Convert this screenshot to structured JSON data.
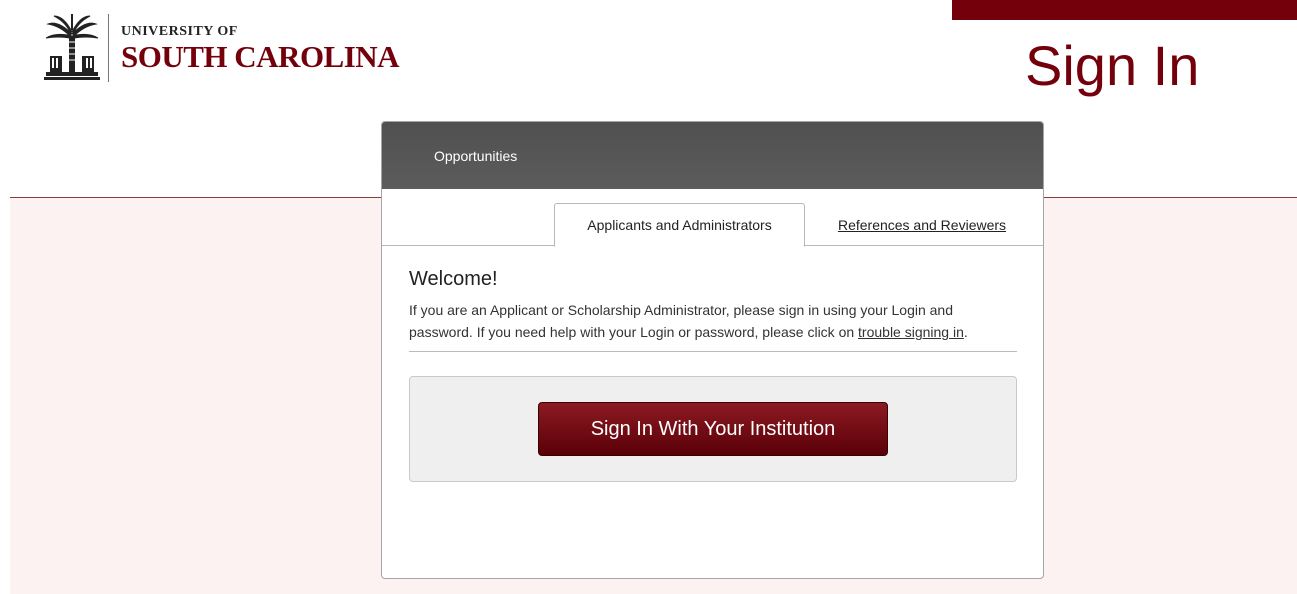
{
  "header": {
    "logo_small": "UNIVERSITY OF",
    "logo_big": "SOUTH CAROLINA",
    "page_title": "Sign In"
  },
  "nav": {
    "opportunities": "Opportunities"
  },
  "tabs": [
    {
      "label": "Applicants and Administrators",
      "active": true
    },
    {
      "label": "References and Reviewers",
      "active": false
    }
  ],
  "welcome": {
    "heading": "Welcome!",
    "text_part1": "If you are an Applicant or Scholarship Administrator, please sign in using your Login and password. If you need help with your Login or password, please click on ",
    "link_text": "trouble signing in",
    "text_part2": "."
  },
  "signin": {
    "button_label": "Sign In With Your Institution"
  },
  "colors": {
    "brand": "#73000a",
    "band_bg": "#fcf2f2",
    "nav_bg": "#555555"
  },
  "icons": {
    "logo": "palmetto-tree-icon"
  }
}
